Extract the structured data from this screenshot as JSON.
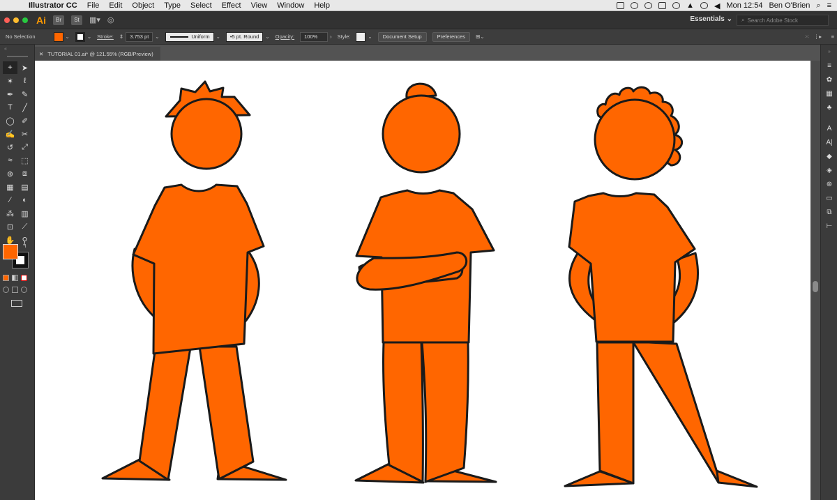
{
  "menubar": {
    "app_name": "Illustrator CC",
    "items": [
      "File",
      "Edit",
      "Object",
      "Type",
      "Select",
      "Effect",
      "View",
      "Window",
      "Help"
    ],
    "clock": "Mon 12:54",
    "user": "Ben O'Brien"
  },
  "appbar": {
    "logo": "Ai",
    "bridge": "Br",
    "stock": "St",
    "workspace": "Essentials",
    "search_placeholder": "Search Adobe Stock"
  },
  "controlbar": {
    "selection": "No Selection",
    "stroke_label": "Stroke:",
    "stroke_weight": "3.753 pt",
    "profile": "Uniform",
    "brush": "5 pt. Round",
    "opacity_label": "Opacity:",
    "opacity_value": "100%",
    "style_label": "Style:",
    "document_setup": "Document Setup",
    "preferences": "Preferences"
  },
  "document": {
    "tab_title": "TUTORIAL 01.ai* @ 121.55% (RGB/Preview)"
  },
  "colors": {
    "fill": "#ff6600",
    "outline": "#1a1a1a"
  },
  "tools": [
    "selection-tool",
    "direct-selection-tool",
    "magic-wand-tool",
    "lasso-tool",
    "pen-tool",
    "curvature-tool",
    "type-tool",
    "line-tool",
    "ellipse-tool",
    "paintbrush-tool",
    "shaper-tool",
    "scissors-tool",
    "rotate-tool",
    "scale-tool",
    "warp-tool",
    "free-transform-tool",
    "shape-builder-tool",
    "perspective-tool",
    "mesh-tool",
    "gradient-tool",
    "eyedropper-tool",
    "blend-tool",
    "symbol-sprayer-tool",
    "graph-tool",
    "artboard-tool",
    "slice-tool",
    "hand-tool",
    "zoom-tool"
  ]
}
